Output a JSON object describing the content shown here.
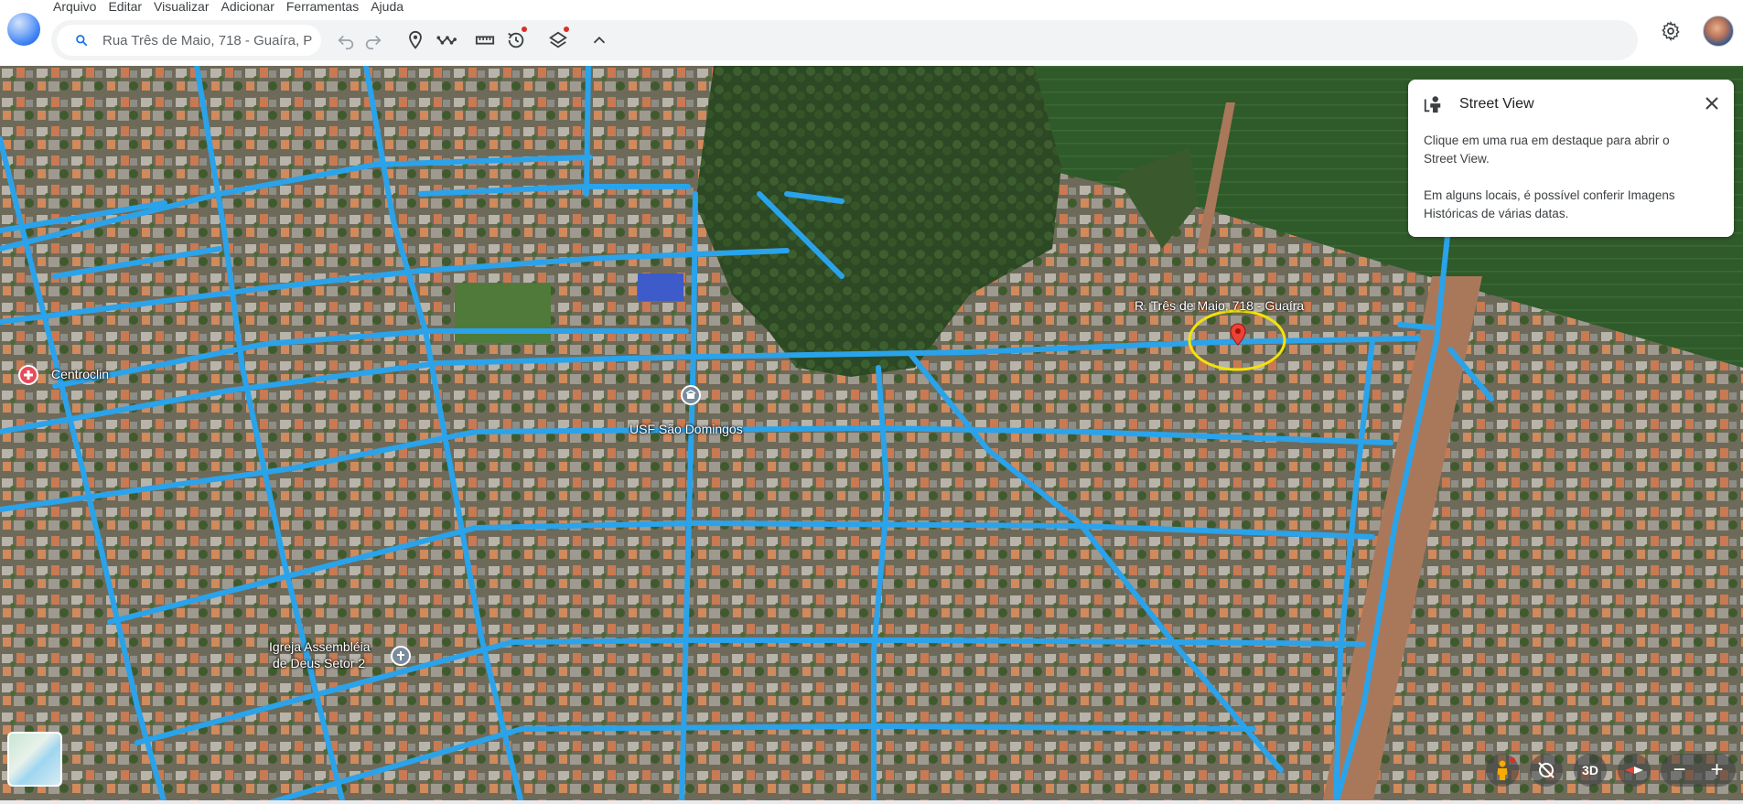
{
  "menu": {
    "items": [
      "Arquivo",
      "Editar",
      "Visualizar",
      "Adicionar",
      "Ferramentas",
      "Ajuda"
    ]
  },
  "toolbar": {
    "search_value": "Rua Três de Maio, 718 - Guaíra, P",
    "icons": [
      "search-icon",
      "undo-icon",
      "redo-icon",
      "placemark-icon",
      "path-icon",
      "ruler-icon",
      "historical-imagery-icon",
      "layers-icon",
      "chevron-up-icon",
      "settings-icon"
    ]
  },
  "map": {
    "labels": {
      "marker": "R. Três de Maio, 718 - Guaíra",
      "usf": "USF São Domingos",
      "centroclin": "Centroclin",
      "igreja_line1": "Igreja Assembléia",
      "igreja_line2": "de Deus Setor 2"
    },
    "colors": {
      "road": "#2aa3ea",
      "marker": "#ea4335",
      "highlight_ellipse": "#f4e20a"
    }
  },
  "street_view": {
    "title": "Street View",
    "text1_line1": "Clique em uma rua em destaque para abrir o",
    "text1_line2": "Street View.",
    "text2_line1": "Em alguns locais, é possível conferir Imagens",
    "text2_line2": "Históricas de várias datas."
  },
  "controls": {
    "three_d": "3D",
    "zoom_out": "−",
    "zoom_in": "+"
  }
}
